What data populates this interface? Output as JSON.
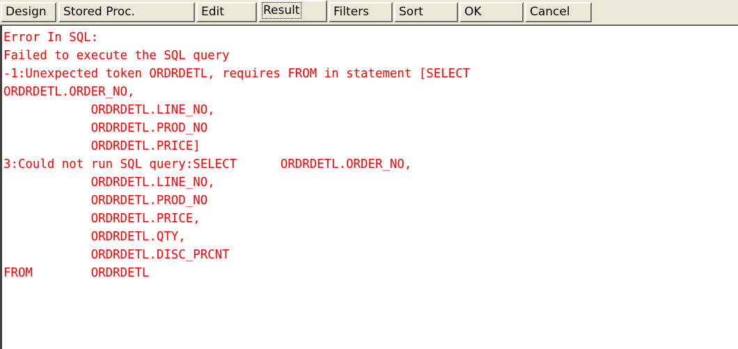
{
  "tabs": [
    {
      "label": "Design",
      "active": false
    },
    {
      "label": "Stored Proc.",
      "active": false
    },
    {
      "label": "Edit",
      "active": false
    },
    {
      "label": "Result",
      "active": true
    },
    {
      "label": "Filters",
      "active": false
    },
    {
      "label": "Sort",
      "active": false
    },
    {
      "label": "OK",
      "active": false
    },
    {
      "label": "Cancel",
      "active": false
    }
  ],
  "output": {
    "text_color": "#ff0000",
    "lines": [
      "Error In SQL:",
      "Failed to execute the SQL query",
      "-1:Unexpected token ORDRDETL, requires FROM in statement [SELECT",
      "ORDRDETL.ORDER_NO,",
      "            ORDRDETL.LINE_NO,",
      "            ORDRDETL.PROD_NO",
      "            ORDRDETL.PRICE]",
      "3:Could not run SQL query:SELECT      ORDRDETL.ORDER_NO,",
      "            ORDRDETL.LINE_NO,",
      "            ORDRDETL.PROD_NO",
      "            ORDRDETL.PRICE,",
      "            ORDRDETL.QTY,",
      "            ORDRDETL.DISC_PRCNT",
      "FROM        ORDRDETL"
    ]
  }
}
